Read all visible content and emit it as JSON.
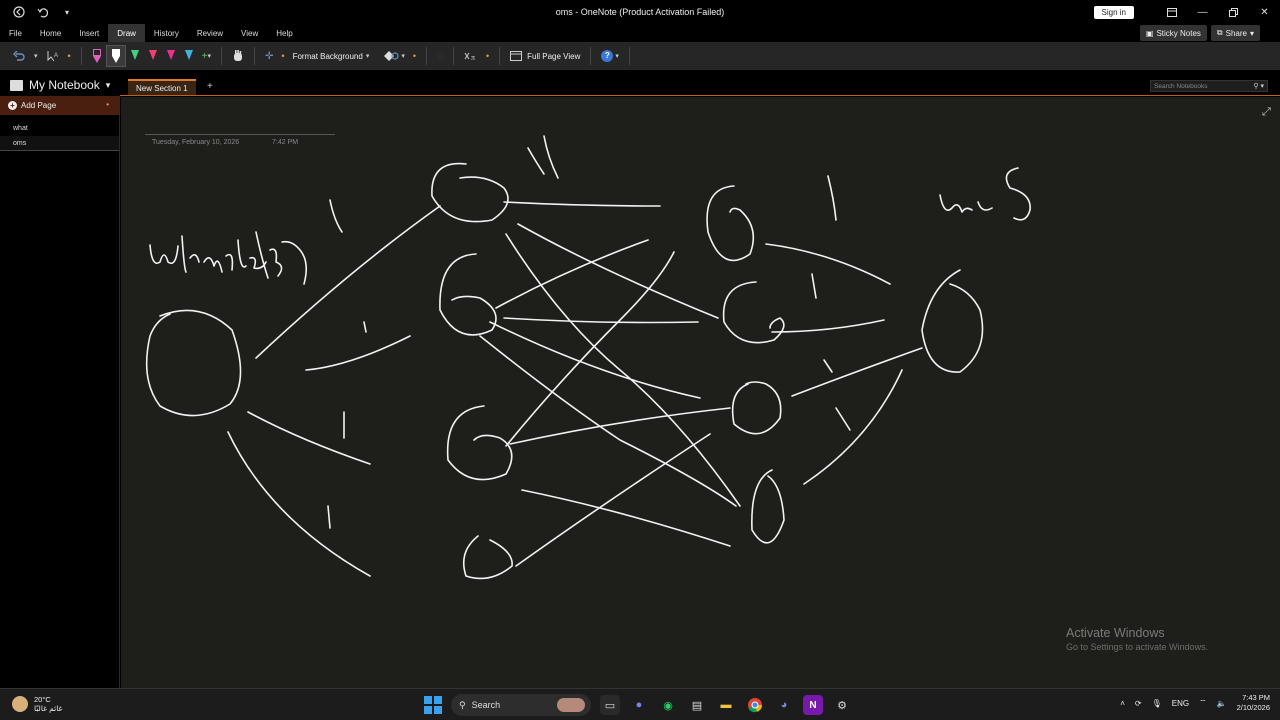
{
  "titlebar": {
    "title": "oms - OneNote (Product Activation Failed)",
    "signin_label": "Sign in"
  },
  "menu": {
    "items": [
      "File",
      "Home",
      "Insert",
      "Draw",
      "History",
      "Review",
      "View",
      "Help"
    ],
    "active": "Draw",
    "sticky_notes": "Sticky Notes",
    "share": "Share"
  },
  "ribbon": {
    "format_background": "Format Background",
    "full_page_view": "Full Page View",
    "pens": [
      "#e060c0",
      "#ffffff",
      "#40d080",
      "#f04070",
      "#f03090",
      "#40b0e0"
    ]
  },
  "notebook": {
    "name": "My Notebook",
    "section_tab": "New Section 1",
    "search_placeholder": "Search Notebooks"
  },
  "pages": {
    "add_page": "Add Page",
    "items": [
      "what",
      "oms"
    ],
    "selected": "oms"
  },
  "page": {
    "date": "Tuesday, February 10, 2026",
    "time": "7:42 PM"
  },
  "watermark": {
    "line1": "Activate Windows",
    "line2": "Go to Settings to activate Windows."
  },
  "taskbar": {
    "weather_temp": "20°C",
    "weather_desc": "غائم غالبًا",
    "search_label": "Search",
    "language": "ENG",
    "time": "7:43 PM",
    "date": "2/10/2026"
  }
}
